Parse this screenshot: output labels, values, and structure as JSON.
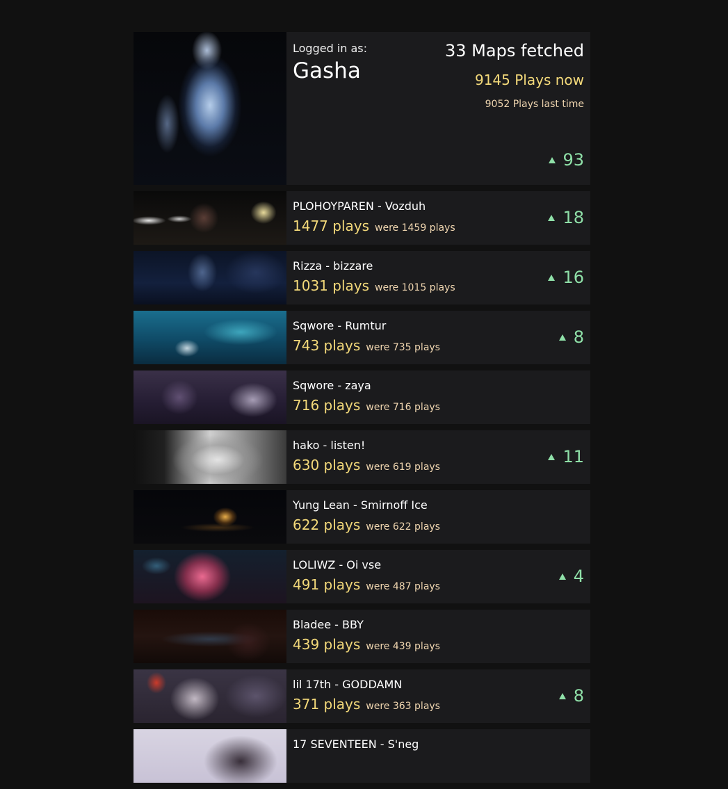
{
  "header": {
    "logged_label": "Logged in as:",
    "username": "Gasha",
    "maps_fetched": "33 Maps fetched",
    "plays_now": "9145 Plays now",
    "plays_last": "9052 Plays last time",
    "delta": "93"
  },
  "maps": [
    {
      "title": "PLOHOYPAREN - Vozduh",
      "plays": "1477 plays",
      "were": "were 1459 plays",
      "delta": "18"
    },
    {
      "title": "Rizza - bizzare",
      "plays": "1031 plays",
      "were": "were 1015 plays",
      "delta": "16"
    },
    {
      "title": "Sqwore - Rumtur",
      "plays": "743 plays",
      "were": "were 735 plays",
      "delta": "8"
    },
    {
      "title": "Sqwore - zaya",
      "plays": "716 plays",
      "were": "were 716 plays",
      "delta": ""
    },
    {
      "title": "hako - listen!",
      "plays": "630 plays",
      "were": "were 619 plays",
      "delta": "11"
    },
    {
      "title": "Yung Lean - Smirnoff Ice",
      "plays": "622 plays",
      "were": "were 622 plays",
      "delta": ""
    },
    {
      "title": "LOLIWZ - Oi vse",
      "plays": "491 plays",
      "were": "were 487 plays",
      "delta": "4"
    },
    {
      "title": "Bladee - BBY",
      "plays": "439 plays",
      "were": "were 439 plays",
      "delta": ""
    },
    {
      "title": "lil 17th - GODDAMN",
      "plays": "371 plays",
      "were": "were 363 plays",
      "delta": "8"
    },
    {
      "title": "17 SEVENTEEN - S'neg",
      "plays": "",
      "were": "",
      "delta": ""
    }
  ],
  "colors": {
    "background": "#111111",
    "card": "#1b1b1d",
    "plays": "#f3d97a",
    "were": "#f0d6b0",
    "delta": "#8fe0a8"
  },
  "icons": {
    "delta": "triangle-up-icon"
  }
}
